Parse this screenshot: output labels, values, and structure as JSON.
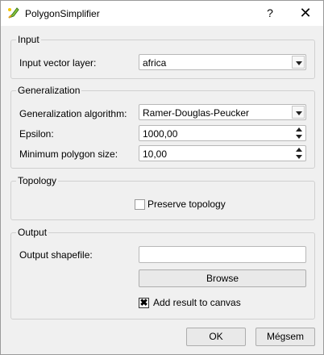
{
  "window": {
    "title": "PolygonSimplifier",
    "help_symbol": "?",
    "close_symbol": "✕"
  },
  "input_group": {
    "title": "Input",
    "layer_label": "Input vector layer:",
    "layer_value": "africa"
  },
  "generalization_group": {
    "title": "Generalization",
    "algorithm_label": "Generalization algorithm:",
    "algorithm_value": "Ramer-Douglas-Peucker",
    "epsilon_label": "Epsilon:",
    "epsilon_value": "1000,00",
    "min_size_label": "Minimum polygon size:",
    "min_size_value": "10,00"
  },
  "topology_group": {
    "title": "Topology",
    "preserve_label": "Preserve topology",
    "preserve_checked": false
  },
  "output_group": {
    "title": "Output",
    "shapefile_label": "Output shapefile:",
    "shapefile_value": "",
    "browse_label": "Browse",
    "add_result_label": "Add result to canvas",
    "add_result_checked": true
  },
  "buttons": {
    "ok_label": "OK",
    "cancel_label": "Mégsem"
  },
  "icons": {
    "app": "qgis-pen-icon",
    "checkmark": "✖"
  }
}
